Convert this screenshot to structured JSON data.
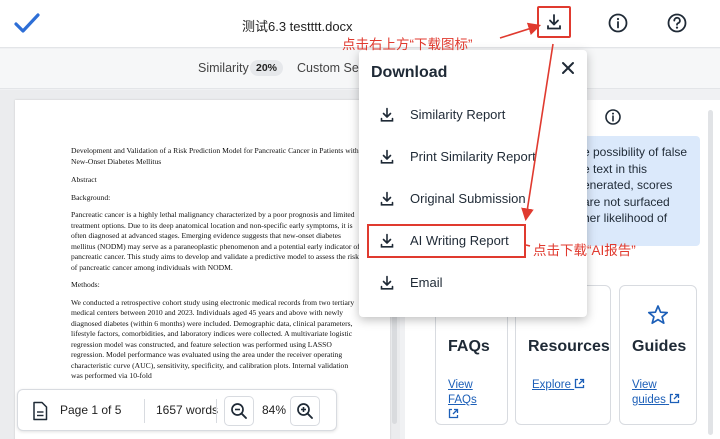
{
  "header": {
    "doc_title": "测试6.3 testttt.docx",
    "icons": [
      "check-icon",
      "download-icon",
      "info-icon",
      "help-icon"
    ]
  },
  "subbar": {
    "similarity_label": "Similarity",
    "similarity_value": "20%",
    "custom_section": "Custom Sect"
  },
  "document": {
    "title": "Development and Validation of a Risk Prediction Model for Pancreatic Cancer in Patients with New-Onset Diabetes Mellitus",
    "abstract_heading": "Abstract",
    "background_heading": "Background:",
    "background_text": "Pancreatic cancer is a highly lethal malignancy characterized by a poor prognosis and limited treatment options. Due to its deep anatomical location and non-specific early symptoms, it is often diagnosed at advanced stages. Emerging evidence suggests that new-onset diabetes mellitus (NODM) may serve as a paraneoplastic phenomenon and a potential early indicator of pancreatic cancer. This study aims to develop and validate a predictive model to assess the risk of pancreatic cancer among individuals with NODM.",
    "methods_heading": "Methods:",
    "methods_text": "We conducted a retrospective cohort study using electronic medical records from two tertiary medical centers between 2010 and 2023. Individuals aged 45 years and above with newly diagnosed diabetes (within 6 months) were included. Demographic data, clinical parameters, lifestyle factors, comorbidities, and laboratory indices were collected. A multivariate logistic regression model was constructed, and feature selection was performed using LASSO regression. Model performance was evaluated using the area under the receiver operating characteristic curve (AUC), sensitivity, specificity, and calibration plots. Internal validation was performed via 10-fold"
  },
  "toolbar": {
    "page_info": "Page 1 of 5",
    "word_count": "1657 words",
    "zoom": "84%"
  },
  "right_panel": {
    "ai_box_lines": [
      "e possibility of false",
      "e text in this",
      "enerated, scores",
      "are not surfaced",
      "her likelihood of"
    ],
    "cards": [
      {
        "title": "FAQs",
        "link": "View FAQs"
      },
      {
        "title": "Resources",
        "link": "Explore"
      },
      {
        "title": "Guides",
        "link": "View guides"
      }
    ]
  },
  "download_menu": {
    "title": "Download",
    "items": [
      {
        "label": "Similarity Report"
      },
      {
        "label": "Print Similarity Report"
      },
      {
        "label": "Original Submission"
      },
      {
        "label": "AI Writing Report"
      },
      {
        "label": "Email"
      }
    ]
  },
  "annotations": {
    "top": "点击右上方“下载图标”",
    "side": "点击下载“AI报告”",
    "color": "#e03a2f"
  },
  "colors": {
    "accent": "#1c5fb8",
    "check": "#2d6ed6",
    "highlight_box": "#dbe9fb"
  }
}
